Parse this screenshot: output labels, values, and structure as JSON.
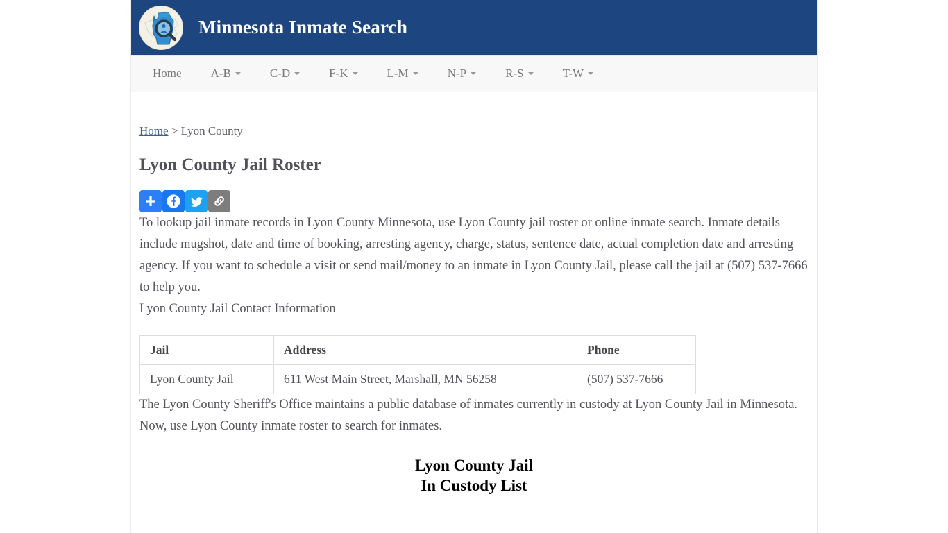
{
  "header": {
    "title": "Minnesota Inmate Search",
    "logo_icon": "minnesota-map-magnifier-logo",
    "background_color": "#1d4580"
  },
  "nav": {
    "items": [
      {
        "label": "Home",
        "has_caret": false
      },
      {
        "label": "A-B",
        "has_caret": true
      },
      {
        "label": "C-D",
        "has_caret": true
      },
      {
        "label": "F-K",
        "has_caret": true
      },
      {
        "label": "L-M",
        "has_caret": true
      },
      {
        "label": "N-P",
        "has_caret": true
      },
      {
        "label": "R-S",
        "has_caret": true
      },
      {
        "label": "T-W",
        "has_caret": true
      }
    ]
  },
  "breadcrumb": {
    "home_label": "Home",
    "separator": ">",
    "current": "Lyon County"
  },
  "page_title": "Lyon County Jail Roster",
  "share": {
    "buttons": [
      {
        "name": "addthis-share-button",
        "icon": "plus-icon",
        "color": "#2d7ff9"
      },
      {
        "name": "facebook-share-button",
        "icon": "facebook-icon",
        "color": "#1877f2"
      },
      {
        "name": "twitter-share-button",
        "icon": "twitter-icon",
        "color": "#1da1f2"
      },
      {
        "name": "copy-link-button",
        "icon": "link-icon",
        "color": "#7d7d7d"
      }
    ]
  },
  "intro_paragraph": "To lookup jail inmate records in Lyon County Minnesota, use Lyon County jail roster or online inmate search. Inmate details include mugshot, date and time of booking, arresting agency, charge, status, sentence date, actual completion date and arresting agency. If you want to schedule a visit or send mail/money to an inmate in Lyon County Jail, please call the jail at (507) 537-7666 to help you.",
  "contact_label": "Lyon County Jail Contact Information",
  "contact_table": {
    "headers": [
      "Jail",
      "Address",
      "Phone"
    ],
    "rows": [
      {
        "jail": "Lyon County Jail",
        "address": "611 West Main Street, Marshall, MN 56258",
        "phone": "(507) 537-7666"
      }
    ]
  },
  "outro_paragraph": "The Lyon County Sheriff's Office maintains a public database of inmates currently in custody at Lyon County Jail in Minnesota. Now, use Lyon County inmate roster to search for inmates.",
  "custody_heading": {
    "line1": "Lyon County Jail",
    "line2": "In Custody List"
  }
}
